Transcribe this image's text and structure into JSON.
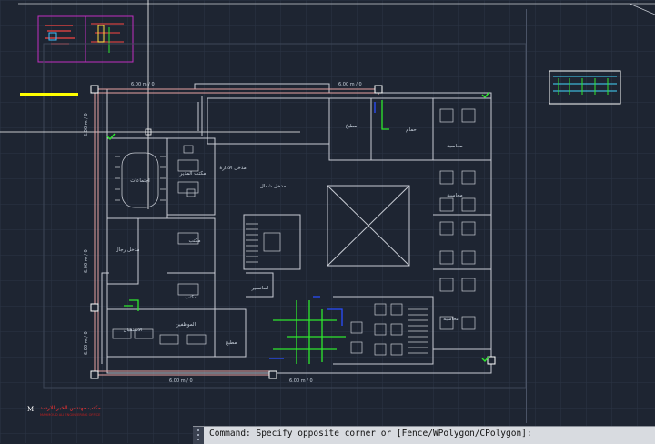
{
  "app": {
    "command_line": "Command: Specify opposite corner or [Fence/WPolygon/CPolygon]:"
  },
  "drawing": {
    "dimension_label": "6.00 m / 0",
    "room_labels": {
      "meeting": "اجتماعات",
      "manager_office": "مكتب المدير",
      "office_1": "مكتب",
      "office_2": "مكتب",
      "corridor": "مدخل رجال",
      "main_entrance": "مدخل شمال",
      "lobby": "مدخل الادارة",
      "stairs": "مطبخ",
      "bathroom": "حمام",
      "reception": "الاستقبال",
      "employees": "الموظفين",
      "open_area_1": "محاسبة",
      "open_area_2": "محاسبة",
      "open_area_3": "محاسبة",
      "elevator": "اسانسير"
    },
    "title_block": {
      "company": "مكتب مهندس الخبر الارشد",
      "subtitle": "MAHMOUD ALI ENGINEERING OFFICE"
    }
  },
  "colors": {
    "background": "#1e2532",
    "wall": "#c8ccd4",
    "duct_outline": "#e8a3a3",
    "pipe_green": "#2ee82e",
    "pipe_blue": "#2a4dff",
    "highlight_yellow": "#ffff00",
    "frame_magenta": "#c030c0",
    "frame_white": "#ffffff"
  }
}
